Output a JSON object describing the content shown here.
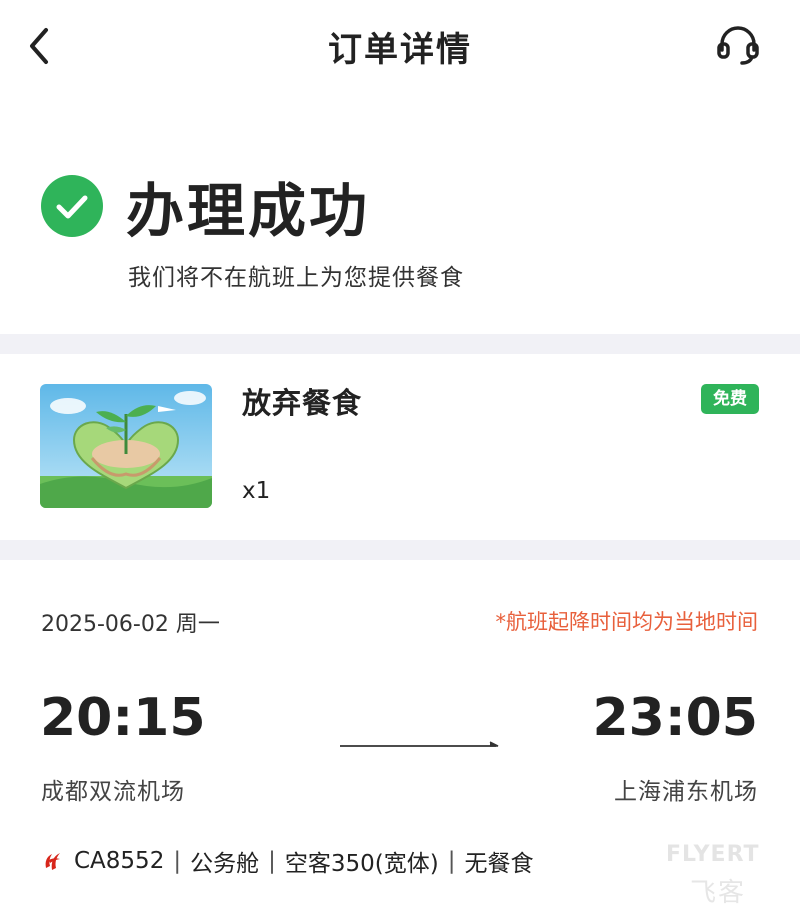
{
  "header": {
    "title": "订单详情",
    "back_icon": "chevron-left-icon",
    "service_icon": "headset-icon"
  },
  "status": {
    "icon": "check-circle-icon",
    "icon_color": "#2fb45a",
    "title": "办理成功",
    "description": "我们将不在航班上为您提供餐食"
  },
  "meal": {
    "name": "放弃餐食",
    "badge": "免费",
    "badge_color": "#2fb45a",
    "quantity": "x1",
    "image": "hands-holding-earth-plant-illustration"
  },
  "flight": {
    "date": "2025-06-02 周一",
    "timezone_note": "*航班起降时间均为当地时间",
    "timezone_note_color": "#e8603c",
    "departure": {
      "time": "20:15",
      "airport": "成都双流机场"
    },
    "arrival": {
      "time": "23:05",
      "airport": "上海浦东机场"
    },
    "airline_logo": "air-china-logo-icon",
    "flight_no": "CA8552",
    "cabin": "公务舱",
    "aircraft": "空客350(宽体)",
    "meal_info": "无餐食",
    "separator": "|"
  },
  "watermark": {
    "brand": "FLYERT",
    "brand_cn": "飞客"
  }
}
